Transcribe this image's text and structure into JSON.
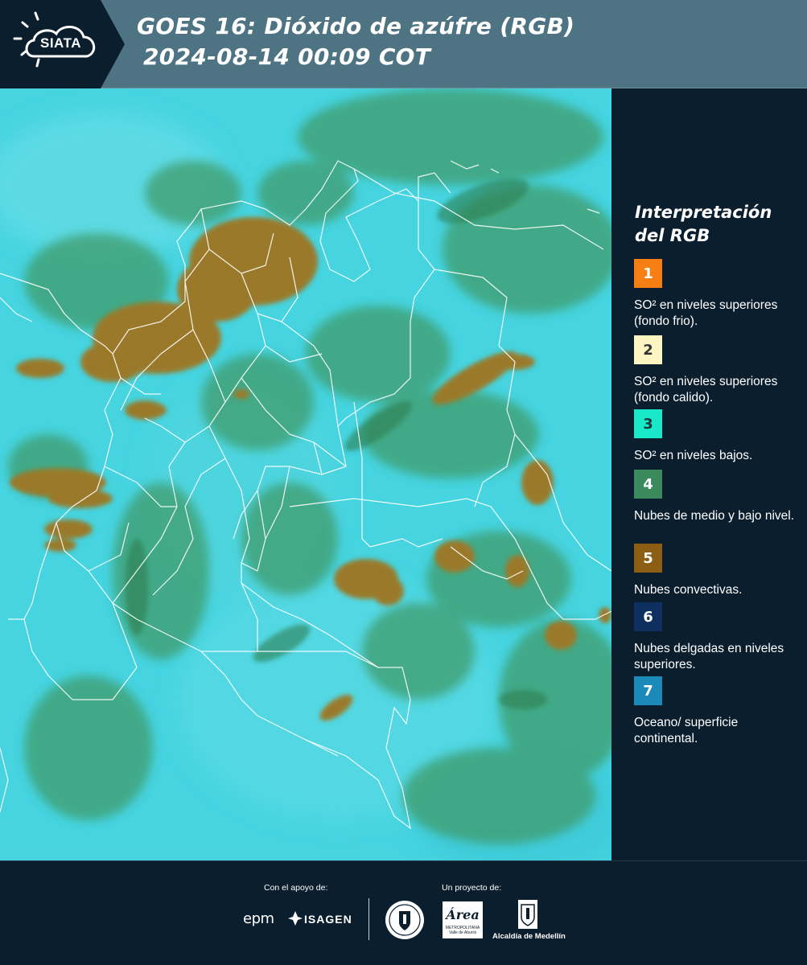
{
  "header": {
    "logo": "SIATA",
    "title": "GOES 16: Dióxido de azúfre (RGB)",
    "subtitle": "2024-08-14 00:09 COT",
    "background_color": "#4e7483"
  },
  "legend": {
    "title": "Interpretación del RGB",
    "items": [
      {
        "number": "1",
        "color": "#f57f12",
        "text_color": "#ffffff",
        "label": "SO² en niveles superiores (fondo frio)."
      },
      {
        "number": "2",
        "color": "#fdf6c3",
        "text_color": "#333333",
        "label": "SO² en niveles superiores (fondo calido)."
      },
      {
        "number": "3",
        "color": "#19e8c9",
        "text_color": "#1a3a40",
        "label": "SO² en niveles bajos."
      },
      {
        "number": "4",
        "color": "#3a8a5e",
        "text_color": "#ffffff",
        "label": "Nubes de medio y bajo nivel."
      },
      {
        "number": "5",
        "color": "#8b5e14",
        "text_color": "#ffffff",
        "label": "Nubes convectivas."
      },
      {
        "number": "6",
        "color": "#0d3060",
        "text_color": "#ffffff",
        "label": "Nubes delgadas en niveles superiores."
      },
      {
        "number": "7",
        "color": "#1b8ab9",
        "text_color": "#ffffff",
        "label": "Oceano/ superficie continental."
      }
    ]
  },
  "footer": {
    "support_label": "Con el apoyo de:",
    "project_label": "Un proyecto de:",
    "sponsors": [
      "epm",
      "ISAGEN"
    ],
    "area_logo": "Área",
    "area_sub": "METROPOLITANA Valle de Aburrá",
    "alcaldia": "Alcaldía de Medellín"
  }
}
